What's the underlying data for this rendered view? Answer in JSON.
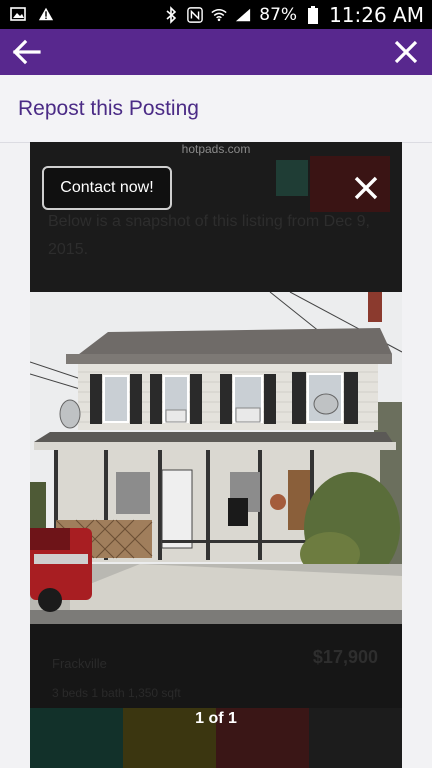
{
  "status_bar": {
    "battery": "87%",
    "time": "11:26 AM",
    "icons": [
      "image-icon",
      "warning-icon",
      "bluetooth-icon",
      "nfc-icon",
      "wifi-icon",
      "signal-icon",
      "battery-icon"
    ]
  },
  "app_bar": {
    "back_icon": "arrow-left-icon",
    "close_icon": "close-icon",
    "color": "#58288e"
  },
  "repost": {
    "title": "Repost this Posting",
    "title_color": "#4b2b86"
  },
  "viewer": {
    "url": "hotpads.com",
    "snapshot_text": "Below is a snapshot of this listing from Dec 9, 2015.",
    "contact_label": "Contact now!",
    "price": "$17,900",
    "address": "Frackville",
    "details": "3 beds   1 bath   1,350 sqft",
    "counter": "1 of 1",
    "photo_description": "house-photo"
  }
}
